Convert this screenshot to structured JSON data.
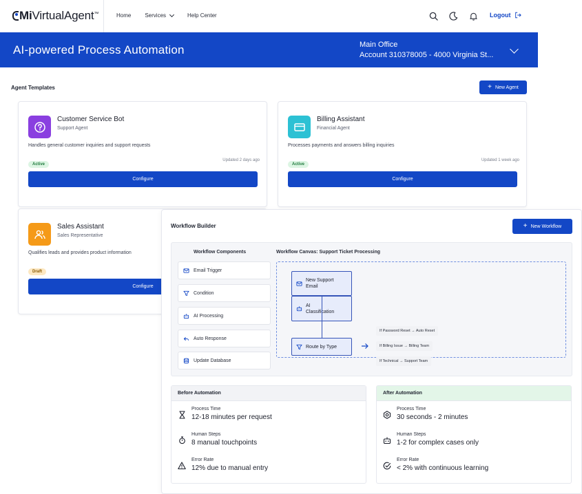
{
  "brand": {
    "name_strong": "Mi",
    "name_rest": "VirtualAgent",
    "tm": "™"
  },
  "nav": {
    "home": "Home",
    "services": "Services",
    "help": "Help Center"
  },
  "header": {
    "logout": "Logout"
  },
  "banner": {
    "title": "AI-powered Process Automation",
    "office": "Main Office",
    "account": "Account 310378005 - 4000 Virginia St..."
  },
  "templates": {
    "section_title": "Agent Templates",
    "new_button": "New Agent",
    "configure_label": "Configure",
    "cards": [
      {
        "name": "Customer Service Bot",
        "role": "Support Agent",
        "desc": "Handles general customer inquiries and support requests",
        "status": "Active",
        "updated": "Updated 2 days ago",
        "icon": "question-circle-icon",
        "color": "#8a3fe0"
      },
      {
        "name": "Billing Assistant",
        "role": "Financial Agent",
        "desc": "Processes payments and answers billing inquiries",
        "status": "Active",
        "updated": "Updated 1 week ago",
        "icon": "credit-card-icon",
        "color": "#2cc1d4"
      },
      {
        "name": "Sales Assistant",
        "role": "Sales Representative",
        "desc": "Qualifies leads and provides product information",
        "status": "Draft",
        "updated": "",
        "icon": "users-icon",
        "color": "#f59a18"
      }
    ]
  },
  "workflow": {
    "title": "Workflow Builder",
    "new_button": "New Workflow",
    "components_title": "Workflow Components",
    "components": [
      {
        "label": "Email Trigger",
        "icon": "mail-icon"
      },
      {
        "label": "Condition",
        "icon": "filter-icon"
      },
      {
        "label": "AI Processing",
        "icon": "robot-icon"
      },
      {
        "label": "Auto Response",
        "icon": "reply-icon"
      },
      {
        "label": "Update Database",
        "icon": "database-icon"
      }
    ],
    "canvas_title": "Workflow Canvas: Support Ticket Processing",
    "nodes": {
      "email_line1": "New Support",
      "email_line2": "Email",
      "ai_line1": "AI",
      "ai_line2": "Classification",
      "route": "Route by Type"
    },
    "conditions": [
      "If Password Reset → Auto Reset",
      "If Billing Issue → Billing Team",
      "If Technical → Support Team"
    ]
  },
  "comparison": {
    "before": {
      "title": "Before Automation",
      "metrics": [
        {
          "label": "Process Time",
          "value": "12-18 minutes per request",
          "icon": "hourglass-icon"
        },
        {
          "label": "Human Steps",
          "value": "8 manual touchpoints",
          "icon": "stopwatch-icon"
        },
        {
          "label": "Error Rate",
          "value": "12% due to manual entry",
          "icon": "warning-icon"
        }
      ]
    },
    "after": {
      "title": "After Automation",
      "metrics": [
        {
          "label": "Process Time",
          "value": "30 seconds - 2 minutes",
          "icon": "gear-hex-icon"
        },
        {
          "label": "Human Steps",
          "value": "1-2 for complex cases only",
          "icon": "robot-icon"
        },
        {
          "label": "Error Rate",
          "value": "< 2% with continuous learning",
          "icon": "check-circle-icon"
        }
      ]
    }
  },
  "colors": {
    "primary": "#1347c6",
    "after_header": "#e3f6e8",
    "before_header": "#f2f3f6"
  }
}
